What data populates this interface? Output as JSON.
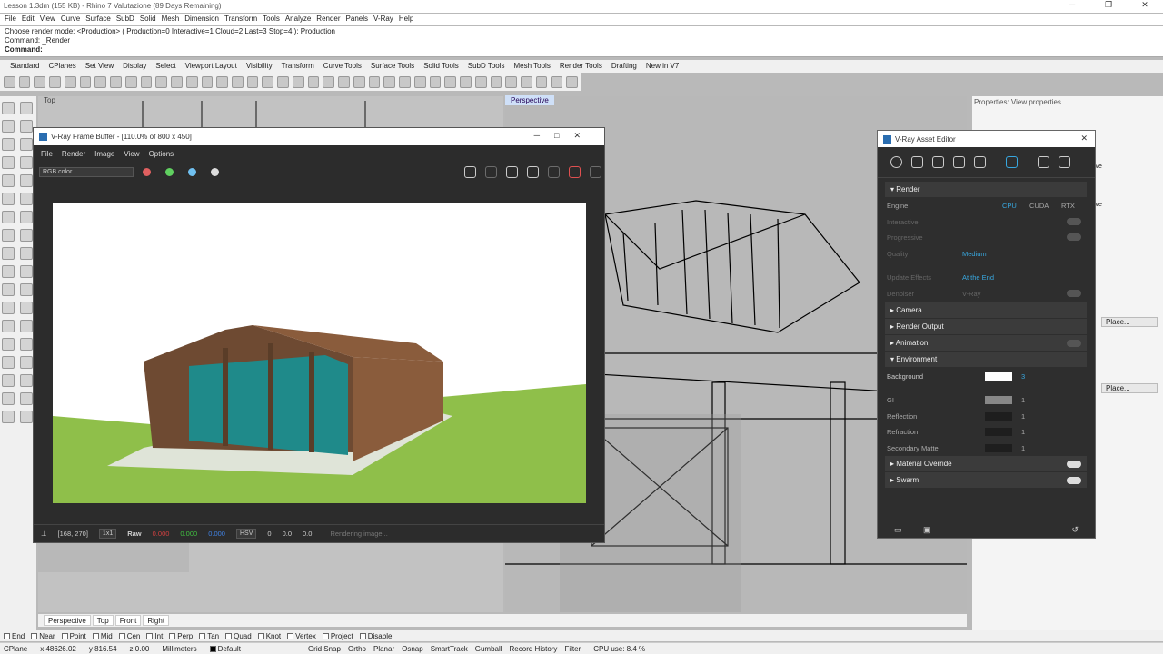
{
  "app": {
    "title": "Lesson 1.3dm (155 KB) - Rhino 7 Valutazione (89 Days Remaining)"
  },
  "menu": [
    "File",
    "Edit",
    "View",
    "Curve",
    "Surface",
    "SubD",
    "Solid",
    "Mesh",
    "Dimension",
    "Transform",
    "Tools",
    "Analyze",
    "Render",
    "Panels",
    "V-Ray",
    "Help"
  ],
  "command": {
    "line1": "Choose render mode: <Production> ( Production=0  Interactive=1  Cloud=2  Last=3  Stop=4 ): Production",
    "line2": "Command: _Render",
    "prompt": "Command:"
  },
  "toolbar_tabs": [
    "Standard",
    "CPlanes",
    "Set View",
    "Display",
    "Select",
    "Viewport Layout",
    "Visibility",
    "Transform",
    "Curve Tools",
    "Surface Tools",
    "Solid Tools",
    "SubD Tools",
    "Mesh Tools",
    "Render Tools",
    "Drafting",
    "New in V7"
  ],
  "viewports": {
    "top": "Top",
    "perspective": "Perspective"
  },
  "bottom_tabs": [
    "Perspective",
    "Top",
    "Front",
    "Right"
  ],
  "osnaps": [
    "End",
    "Near",
    "Point",
    "Mid",
    "Cen",
    "Int",
    "Perp",
    "Tan",
    "Quad",
    "Knot",
    "Vertex",
    "Project",
    "Disable"
  ],
  "status": {
    "cplane": "CPlane",
    "x": "x 48626.02",
    "y": "y 816.54",
    "z": "z 0.00",
    "units": "Millimeters",
    "layer": "Default",
    "items": [
      "Grid Snap",
      "Ortho",
      "Planar",
      "Osnap",
      "SmartTrack",
      "Gumball",
      "Record History",
      "Filter"
    ],
    "cpu": "CPU use: 8.4 %"
  },
  "properties": {
    "header": "Properties: View properties",
    "place1": "Place...",
    "place2": "Place...",
    "frag1": "ive",
    "frag2": "ive"
  },
  "vfb": {
    "title": "V-Ray Frame Buffer - [110.0% of 800 x 450]",
    "menu": [
      "File",
      "Render",
      "Image",
      "View",
      "Options"
    ],
    "channel": "RGB color",
    "coords": "[168, 270]",
    "ratio": "1x1",
    "raw": "Raw",
    "r": "0.000",
    "g": "0.000",
    "b": "0.000",
    "mode": "HSV",
    "h": "0",
    "s": "0.0",
    "v": "0.0",
    "progress": "Rendering image..."
  },
  "asset_editor": {
    "title": "V-Ray Asset Editor",
    "render_label": "Render",
    "engine_label": "Engine",
    "engines": [
      "CPU",
      "CUDA",
      "RTX"
    ],
    "interactive": "Interactive",
    "progressive": "Progressive",
    "quality": "Quality",
    "quality_val": "Medium",
    "update_effects": "Update Effects",
    "update_val": "At the End",
    "denoiser": "Denoiser",
    "denoiser_val": "V-Ray",
    "camera": "Camera",
    "render_output": "Render Output",
    "animation": "Animation",
    "environment": "Environment",
    "background": "Background",
    "bg_val": "3",
    "gi": "GI",
    "reflection": "Reflection",
    "refraction": "Refraction",
    "secondary_matte": "Secondary Matte",
    "one": "1",
    "material_override": "Material Override",
    "swarm": "Swarm"
  },
  "colors": {
    "accent": "#38a8e0",
    "grass": "#8fbf4a",
    "wall": "#7a5236",
    "glass": "#1f8a8a"
  }
}
